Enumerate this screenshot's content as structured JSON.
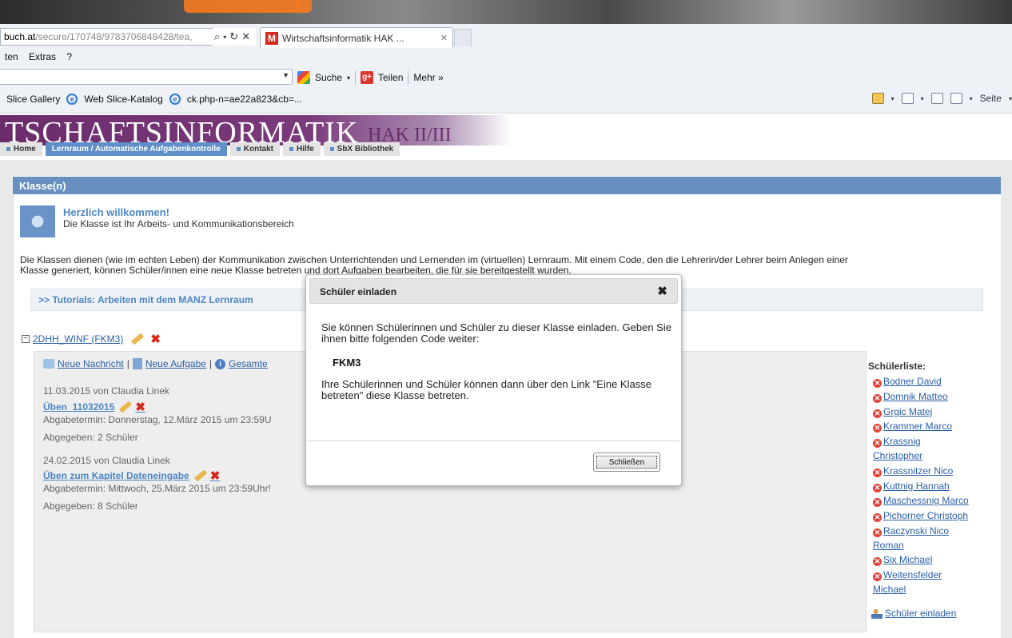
{
  "browser": {
    "address_domain": "buch.at",
    "address_path": "/secure/170748/9783706848428/tea,",
    "tab_title": "Wirtschaftsinformatik HAK ...",
    "menu": [
      "ten",
      "Extras",
      "?"
    ],
    "search_label": "Suche",
    "share_label": "Teilen",
    "more_label": "Mehr »",
    "favorites": [
      "Slice Gallery",
      "Web Slice-Katalog",
      "ck.php-n=ae22a823&cb=..."
    ],
    "page_menu": "Seite"
  },
  "site": {
    "brand": "TSCHAFTSINFORMATIK",
    "brand_sub": "HAK II/III",
    "nav": [
      "Home",
      "Lernraum / Automatische Aufgabenkontrolle",
      "Kontakt",
      "Hilfe",
      "SbX Bibliothek"
    ]
  },
  "page": {
    "section_title": "Klasse(n)",
    "welcome_title": "Herzlich willkommen!",
    "welcome_sub": "Die Klasse ist Ihr Arbeits- und Kommunikationsbereich",
    "intro_line1": "Die Klassen dienen (wie im echten Leben) der Kommunikation zwischen Unterrichtenden und Lernenden im (virtuellen) Lernraum. Mit einem Code, den die Lehrerin/der Lehrer beim Anlegen einer",
    "intro_line2": "Klasse generiert, können Schüler/innen eine neue Klasse betreten und dort Aufgaben bearbeiten, die für sie bereitgestellt wurden.",
    "tutorial_link": ">> Tutorials: Arbeiten mit dem MANZ Lernraum",
    "class_name": "2DHH_WINF (FKM3)",
    "actions": [
      "Neue Nachricht",
      "Neue Aufgabe",
      "Gesamte"
    ],
    "entries": [
      {
        "date_author": "11.03.2015 von Claudia Linek",
        "title": "Üben_11032015",
        "deadline": "Abgabetermin: Donnerstag, 12.März 2015 um 23:59U",
        "submitted": "Abgegeben: 2 Schüler"
      },
      {
        "date_author": "24.02.2015 von Claudia Linek",
        "title": "Üben zum Kapitel Dateneingabe",
        "deadline": "Abgabetermin: Mittwoch, 25.März 2015 um 23:59Uhr!",
        "submitted": "Abgegeben: 8 Schüler"
      }
    ]
  },
  "student_list": {
    "title": "Schülerliste:",
    "students": [
      "Bodner David",
      "Domnik Matteo",
      "Grgic Matej",
      "Krammer Marco",
      "Krassnig Christopher",
      "Krassnitzer Nico",
      "Kuttnig Hannah",
      "Maschessnig Marco",
      "Pichorner Christoph",
      "Raczynski Nico Roman",
      "Six Michael",
      "Weitensfelder Michael"
    ],
    "invite_label": "Schüler einladen"
  },
  "dialog": {
    "title": "Schüler einladen",
    "text1": "Sie können Schülerinnen und Schüler zu dieser Klasse einladen. Geben Sie ihnen bitte folgenden Code weiter:",
    "code": "FKM3",
    "text2": "Ihre Schülerinnen und Schüler können dann über den Link \"Eine Klasse betreten\" diese Klasse betreten.",
    "close_label": "Schließen"
  }
}
